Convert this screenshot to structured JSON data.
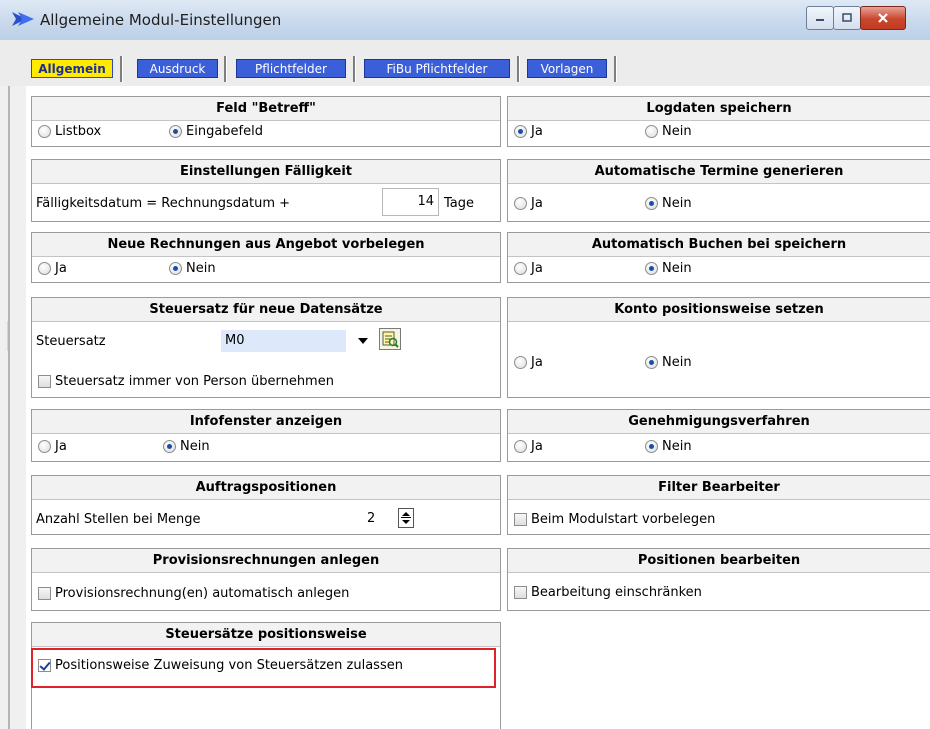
{
  "window": {
    "title": "Allgemeine Modul-Einstellungen"
  },
  "tabs": [
    {
      "label": "Allgemein",
      "active": true
    },
    {
      "label": "Ausdruck",
      "active": false
    },
    {
      "label": "Pflichtfelder",
      "active": false
    },
    {
      "label": "FiBu Pflichtfelder",
      "active": false
    },
    {
      "label": "Vorlagen",
      "active": false
    }
  ],
  "left": {
    "betreff": {
      "title": "Feld \"Betreff\"",
      "opt1": "Listbox",
      "opt2": "Eingabefeld",
      "selected": "Eingabefeld"
    },
    "faelligkeit": {
      "title": "Einstellungen Fälligkeit",
      "label": "Fälligkeitsdatum = Rechnungsdatum +",
      "value": "14",
      "unit": "Tage"
    },
    "angebot": {
      "title": "Neue Rechnungen aus Angebot vorbelegen",
      "opt1": "Ja",
      "opt2": "Nein",
      "selected": "Nein"
    },
    "steuersatz": {
      "title": "Steuersatz für neue Datensätze",
      "label": "Steuersatz",
      "value": "M0",
      "checkbox": "Steuersatz immer von Person übernehmen",
      "checked": false
    },
    "infofenster": {
      "title": "Infofenster anzeigen",
      "opt1": "Ja",
      "opt2": "Nein",
      "selected": "Nein"
    },
    "auftragspos": {
      "title": "Auftragspositionen",
      "label": "Anzahl Stellen bei Menge",
      "value": "2"
    },
    "provision": {
      "title": "Provisionsrechnungen anlegen",
      "checkbox": "Provisionsrechnung(en) automatisch anlegen",
      "checked": false
    },
    "steuerpos": {
      "title": "Steuersätze positionsweise",
      "checkbox": "Positionsweise Zuweisung von Steuersätzen zulassen",
      "checked": true
    }
  },
  "right": {
    "logdaten": {
      "title": "Logdaten speichern",
      "opt1": "Ja",
      "opt2": "Nein",
      "selected": "Ja"
    },
    "termine": {
      "title": "Automatische Termine generieren",
      "opt1": "Ja",
      "opt2": "Nein",
      "selected": "Nein"
    },
    "buchen": {
      "title": "Automatisch Buchen bei speichern",
      "opt1": "Ja",
      "opt2": "Nein",
      "selected": "Nein"
    },
    "konto": {
      "title": "Konto positionsweise setzen",
      "opt1": "Ja",
      "opt2": "Nein",
      "selected": "Nein"
    },
    "genehmigung": {
      "title": "Genehmigungsverfahren",
      "opt1": "Ja",
      "opt2": "Nein",
      "selected": "Nein"
    },
    "filter": {
      "title": "Filter Bearbeiter",
      "checkbox": "Beim Modulstart vorbelegen",
      "checked": false
    },
    "positionen": {
      "title": "Positionen bearbeiten",
      "checkbox": "Bearbeitung einschränken",
      "checked": false
    }
  },
  "colors": {
    "tab": "#3a5fd8",
    "tab_active": "#ffea00",
    "highlight": "#e0202a"
  }
}
